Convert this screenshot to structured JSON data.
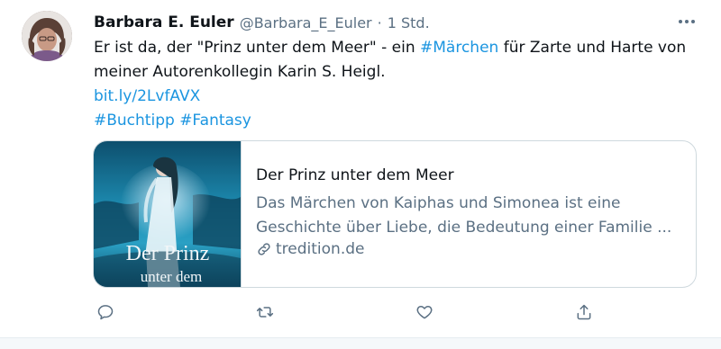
{
  "tweet": {
    "author_name": "Barbara E. Euler",
    "handle": "@Barbara_E_Euler",
    "separator": "·",
    "time": "1 Std.",
    "text": {
      "part1": "Er ist da, der \"Prinz unter dem Meer\" - ein ",
      "hashtag1": "#Märchen",
      "part2": " für Zarte und Harte von meiner Autorenkollegin Karin S. Heigl.",
      "link": "bit.ly/2LvfAVX",
      "hashtag2": "#Buchtipp",
      "hashtag3": "#Fantasy"
    }
  },
  "card": {
    "title": "Der Prinz unter dem Meer",
    "description": "Das Märchen von Kaiphas und Simonea ist eine Geschichte über Liebe, die Bedeutung einer Familie ...",
    "domain": "tredition.de",
    "cover_text_line1": "Der Prinz",
    "cover_text_line2": "unter dem"
  },
  "actions": {
    "reply_icon": "reply-icon",
    "retweet_icon": "retweet-icon",
    "like_icon": "heart-icon",
    "share_icon": "share-icon"
  },
  "colors": {
    "link": "#1b95e0",
    "secondary_text": "#5b7083",
    "border": "#cfd9de"
  }
}
